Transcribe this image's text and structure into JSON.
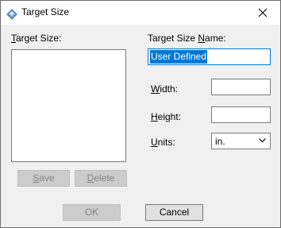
{
  "window": {
    "title": "Target Size"
  },
  "left": {
    "list_label": "Target Size:",
    "list_items": [],
    "save_label": "Save",
    "delete_label": "Delete"
  },
  "right": {
    "name_label": "Target Size Name:",
    "name_value": "User Defined",
    "width_label": "Width:",
    "width_value": "",
    "height_label": "Height:",
    "height_value": "",
    "units_label": "Units:",
    "units_value": "in."
  },
  "footer": {
    "ok_label": "OK",
    "cancel_label": "Cancel"
  },
  "icons": {
    "app": "target-size-app-icon",
    "close": "close-icon",
    "dropdown": "chevron-down-icon"
  }
}
